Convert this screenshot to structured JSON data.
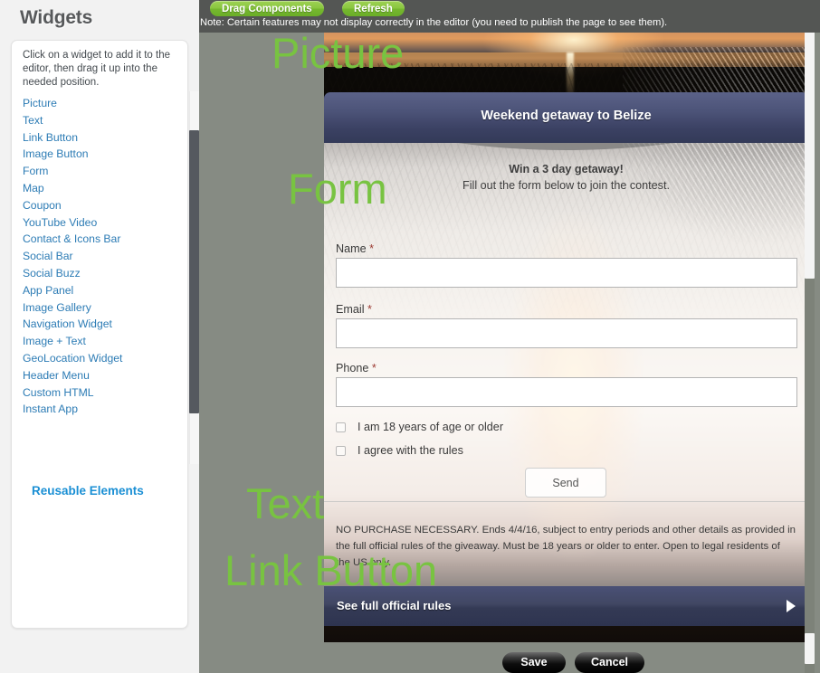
{
  "sidebar": {
    "title": "Widgets",
    "hint": "Click on a widget to add it to the editor, then drag it up into the needed position.",
    "widgets": [
      {
        "label": "Picture"
      },
      {
        "label": "Text"
      },
      {
        "label": "Link Button"
      },
      {
        "label": "Image Button"
      },
      {
        "label": "Form"
      },
      {
        "label": "Map"
      },
      {
        "label": "Coupon"
      },
      {
        "label": "YouTube Video"
      },
      {
        "label": "Contact & Icons Bar"
      },
      {
        "label": "Social Bar"
      },
      {
        "label": "Social Buzz"
      },
      {
        "label": "App Panel"
      },
      {
        "label": "Image Gallery"
      },
      {
        "label": "Navigation Widget"
      },
      {
        "label": "Image + Text"
      },
      {
        "label": "GeoLocation Widget"
      },
      {
        "label": "Header Menu"
      },
      {
        "label": "Custom HTML"
      },
      {
        "label": "Instant App"
      }
    ],
    "reusable_heading": "Reusable Elements"
  },
  "toolbar": {
    "drag_components_label": "Drag Components",
    "refresh_label": "Refresh",
    "note": "Note: Certain features may not display correctly in the editor (you need to publish the page to see them).",
    "accent_green": "#7AC143"
  },
  "overlays": {
    "color": "#78C341",
    "picture": "Picture",
    "form": "Form",
    "text": "Text",
    "link_button": "Link Button"
  },
  "page": {
    "header_title": "Weekend getaway to Belize",
    "header_color": "#3B4163",
    "tagline_bold": "Win a 3 day getaway!",
    "tagline_sub": "Fill out the form below to join the contest.",
    "form": {
      "fields": [
        {
          "label": "Name",
          "required": "*",
          "value": "",
          "placeholder": ""
        },
        {
          "label": "Email",
          "required": "*",
          "value": "",
          "placeholder": ""
        },
        {
          "label": "Phone",
          "required": "*",
          "value": "",
          "placeholder": ""
        }
      ],
      "checkboxes": [
        {
          "label": "I am 18 years of age or older",
          "checked": false
        },
        {
          "label": "I agree with the rules",
          "checked": false
        }
      ],
      "submit_label": "Send"
    },
    "legal_text": "NO PURCHASE NECESSARY. Ends 4/4/16, subject to entry periods and other details as provided in the full official rules of the giveaway. Must be 18 years or older to enter. Open to legal residents of the US only.",
    "link_button_label": "See full official rules"
  },
  "footer": {
    "save_label": "Save",
    "cancel_label": "Cancel"
  }
}
